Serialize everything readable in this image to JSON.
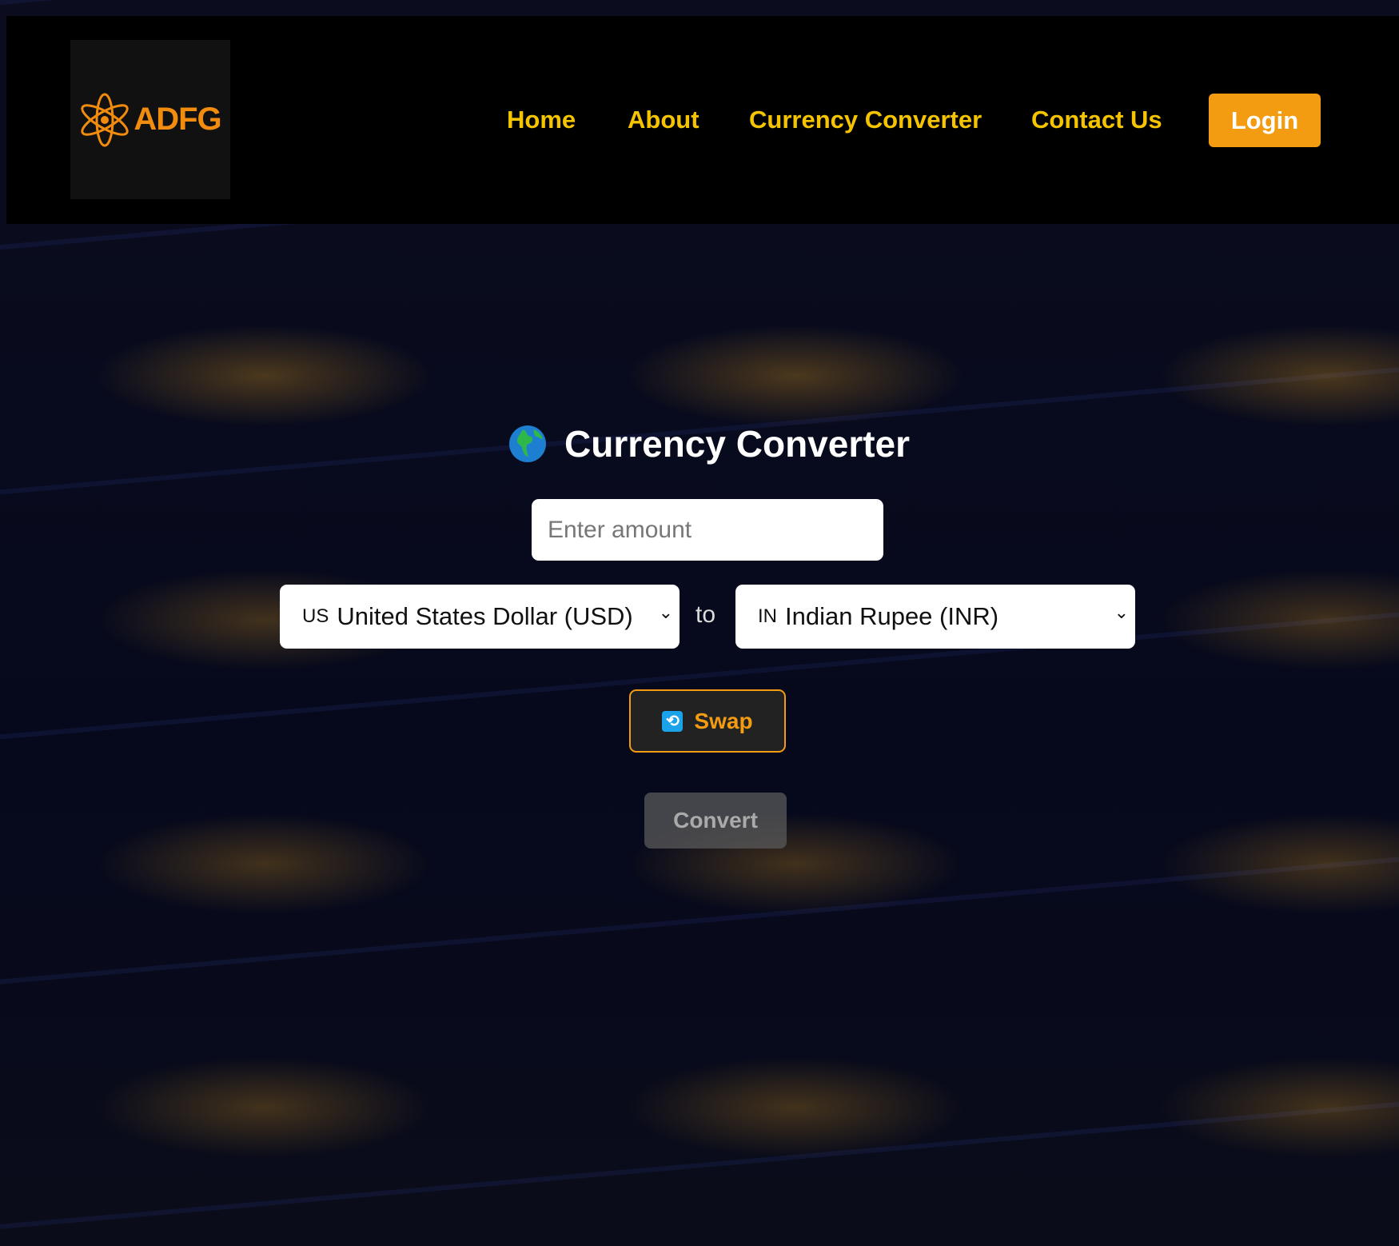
{
  "header": {
    "logo_text": "ADFG",
    "nav": [
      "Home",
      "About",
      "Currency Converter",
      "Contact Us"
    ],
    "login_label": "Login"
  },
  "main": {
    "title": "Currency Converter",
    "title_icon": "globe-icon",
    "amount_placeholder": "Enter amount",
    "from": {
      "code": "US",
      "label": "United States Dollar (USD)"
    },
    "to_label": "to",
    "to": {
      "code": "IN",
      "label": "Indian Rupee (INR)"
    },
    "swap_label": "Swap",
    "swap_icon": "swap-arrows-icon",
    "convert_label": "Convert"
  },
  "colors": {
    "accent": "#f39c12",
    "nav_text": "#f5c400",
    "logo": "#f28c0f"
  }
}
